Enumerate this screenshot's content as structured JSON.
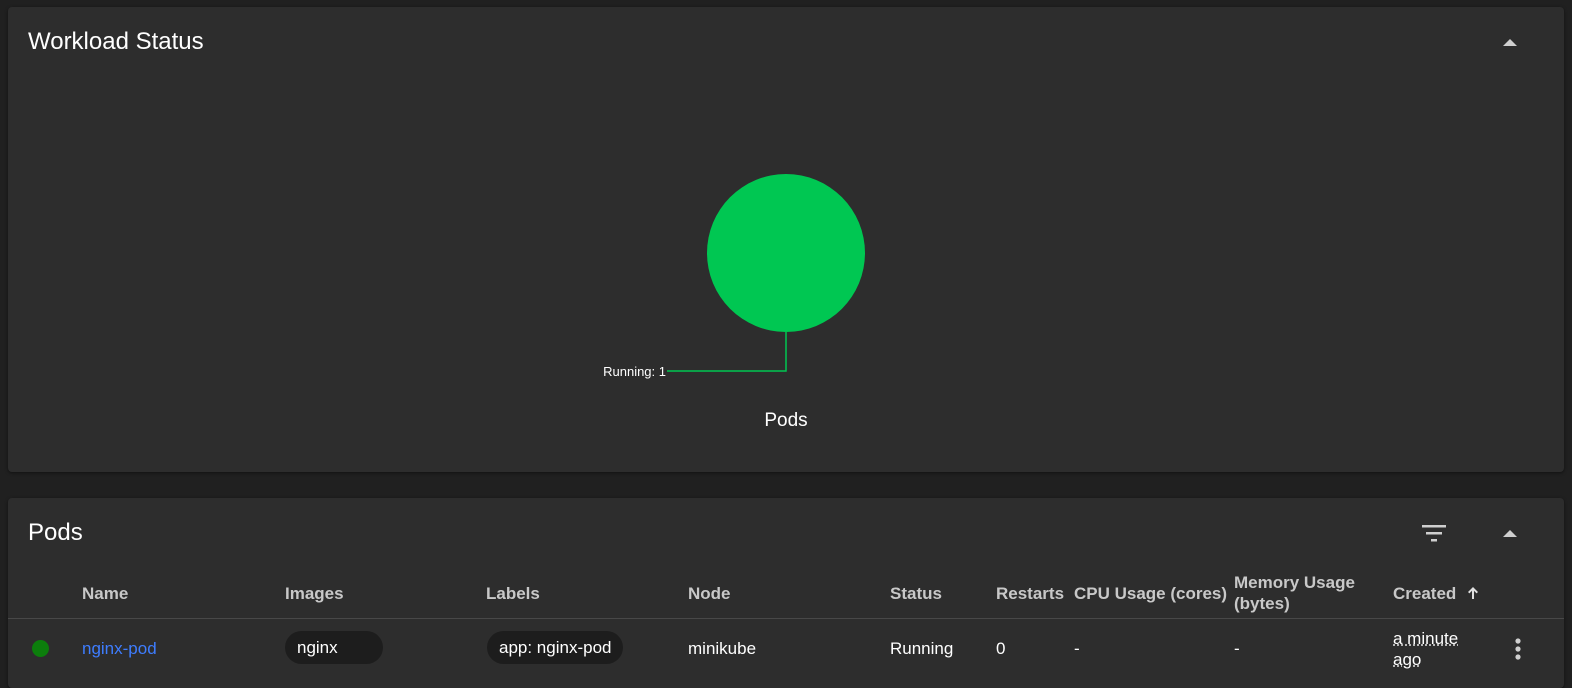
{
  "workload_status": {
    "title": "Workload Status",
    "collapse_icon": "chevron-up-icon"
  },
  "chart_data": {
    "type": "pie",
    "title": "Pods",
    "slices": [
      {
        "label": "Running",
        "value": 1,
        "color": "#00c752"
      }
    ],
    "annotation": "Running: 1"
  },
  "pods": {
    "title": "Pods",
    "filter_icon": "filter-icon",
    "collapse_icon": "chevron-up-icon",
    "columns": {
      "name": "Name",
      "images": "Images",
      "labels": "Labels",
      "node": "Node",
      "status": "Status",
      "restarts": "Restarts",
      "cpu": "CPU Usage (cores)",
      "memory_line1": "Memory Usage",
      "memory_line2": "(bytes)",
      "created": "Created",
      "sort_icon": "arrow-up-icon"
    },
    "rows": [
      {
        "status_color": "#0c7e0c",
        "name": "nginx-pod",
        "image": "nginx",
        "label": "app: nginx-pod",
        "node": "minikube",
        "status": "Running",
        "restarts": "0",
        "cpu": "-",
        "memory": "-",
        "created_line1": "a minute",
        "created_line2": "ago",
        "menu_icon": "more-vert-icon"
      }
    ]
  }
}
